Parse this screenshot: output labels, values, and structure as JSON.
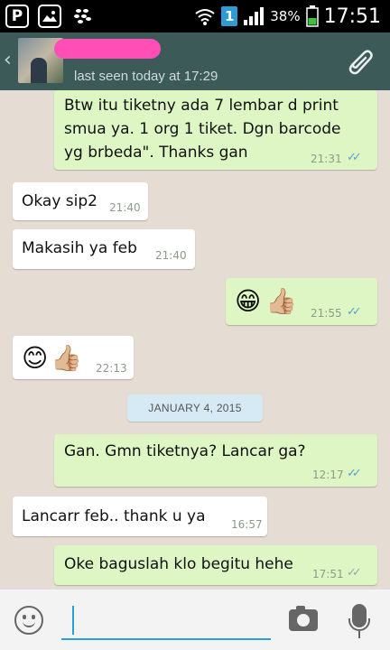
{
  "status_bar": {
    "battery_percent": "38%",
    "sim_indicator": "1",
    "time": "17:51",
    "icons": [
      "pinterest-icon",
      "gallery-icon",
      "bbm-icon",
      "wifi-icon",
      "signal-icon",
      "battery-icon"
    ]
  },
  "header": {
    "back_icon": "chevron-left-icon",
    "last_seen": "last seen today at 17:29",
    "attach_icon": "paperclip-icon",
    "colors": {
      "bar": "#3c5a57",
      "redaction": "#ff4fb6"
    }
  },
  "messages": [
    {
      "dir": "out",
      "lines": [
        "Btw itu tiketny ada 7 lembar d print",
        "smua ya. 1 org 1 tiket. Dgn barcode",
        "yg brbeda\". Thanks gan"
      ],
      "time": "21:31",
      "ticks": "read"
    },
    {
      "dir": "in",
      "lines": [
        "Okay sip2"
      ],
      "time": "21:40"
    },
    {
      "dir": "in",
      "lines": [
        "Makasih ya feb"
      ],
      "time": "21:40"
    },
    {
      "dir": "out",
      "emoji": "grin-thumbs-up",
      "time": "21:55",
      "ticks": "read"
    },
    {
      "dir": "in",
      "emoji": "smile-thumbs-up",
      "time": "22:13"
    },
    {
      "dir": "out",
      "lines": [
        "Gan. Gmn tiketnya? Lancar ga?"
      ],
      "time": "12:17",
      "ticks": "read"
    },
    {
      "dir": "in",
      "lines": [
        "Lancarr feb.. thank u ya"
      ],
      "time": "16:57"
    },
    {
      "dir": "out",
      "lines": [
        "Oke baguslah klo begitu hehe"
      ],
      "time": "17:51",
      "ticks": "delivered"
    }
  ],
  "date_divider": "JANUARY 4, 2015",
  "input_bar": {
    "value": "",
    "icons": [
      "smiley-icon",
      "camera-icon",
      "microphone-icon"
    ],
    "accent": "#2a9fd4"
  }
}
